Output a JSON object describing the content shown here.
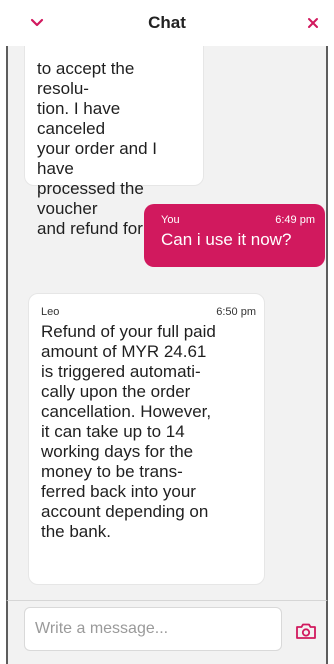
{
  "header": {
    "title": "Chat",
    "back_icon": "chevron-down-icon",
    "close_icon": "close-icon",
    "accent_color": "#d1195e"
  },
  "messages": [
    {
      "sender": "",
      "time": "",
      "text": "to accept the resolu-\ntion. I have canceled\nyour order and I have\nprocessed the voucher\nand refund for you."
    },
    {
      "sender": "You",
      "time": "6:49 pm",
      "text": "Can i use it now?"
    },
    {
      "sender": "Leo",
      "time": "6:50 pm",
      "text": "Refund of your full paid\namount of MYR 24.61\nis triggered automati-\ncally upon the order\ncancellation. However,\nit can take up to 14\nworking days for the\nmoney to be trans-\nferred back into your\naccount depending on\nthe bank."
    }
  ],
  "input": {
    "placeholder": "Write a message...",
    "value": "",
    "camera_icon": "camera-icon"
  }
}
